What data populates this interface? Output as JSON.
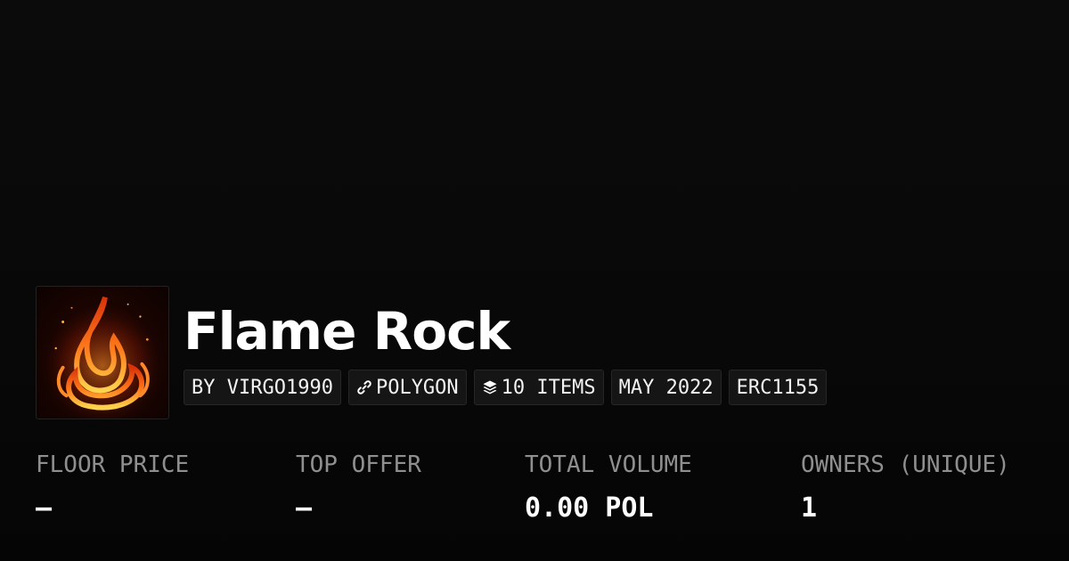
{
  "collection": {
    "name": "Flame Rock",
    "avatar_icon": "flame-icon"
  },
  "tags": {
    "creator": "BY VIRGO1990",
    "chain": "POLYGON",
    "chain_icon": "polygon-link-icon",
    "items": "10 ITEMS",
    "items_icon": "layers-icon",
    "date": "MAY 2022",
    "standard": "ERC1155"
  },
  "stats": {
    "floor_price": {
      "label": "FLOOR PRICE",
      "value": "–"
    },
    "top_offer": {
      "label": "TOP OFFER",
      "value": "–"
    },
    "total_volume": {
      "label": "TOTAL VOLUME",
      "value": "0.00 POL"
    },
    "owners": {
      "label": "OWNERS (UNIQUE)",
      "value": "1"
    }
  },
  "colors": {
    "background": "#0a0a0a",
    "tag_background": "#151515",
    "label_gray": "#8f8f8f",
    "flame_orange": "#ff7a1a"
  }
}
